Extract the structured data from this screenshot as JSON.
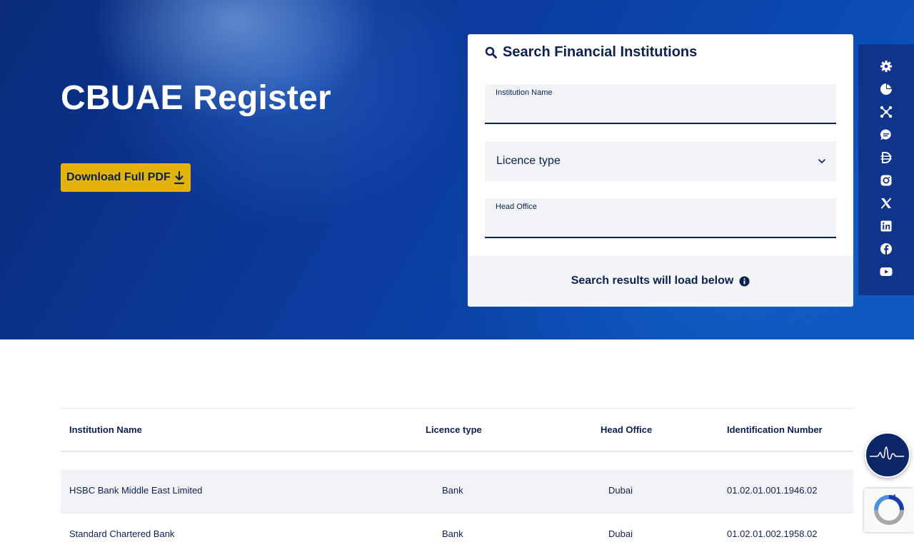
{
  "hero": {
    "title": "CBUAE Register",
    "download_label": "Download Full PDF"
  },
  "search": {
    "title": "Search Financial Institutions",
    "institution_label": "Institution Name",
    "licence_placeholder": "Licence type",
    "head_office_label": "Head Office",
    "footer_text": "Search results will load below"
  },
  "social_icons": [
    "gear-icon",
    "pie-chart-icon",
    "network-icon",
    "chat-icon",
    "dirham-icon",
    "instagram-icon",
    "x-icon",
    "linkedin-icon",
    "facebook-icon",
    "youtube-icon"
  ],
  "table": {
    "headers": [
      "Institution Name",
      "Licence type",
      "Head Office",
      "Identification Number"
    ],
    "rows": [
      [
        "HSBC Bank Middle East Limited",
        "Bank",
        "Dubai",
        "01.02.01.001.1946.02"
      ],
      [
        "Standard Chartered Bank",
        "Bank",
        "Dubai",
        "01.02.01.002.1958.02"
      ]
    ]
  },
  "colors": {
    "navy": "#0d2052",
    "accent_yellow": "#e3b30a",
    "hero_blue": "#0b3a9a"
  }
}
